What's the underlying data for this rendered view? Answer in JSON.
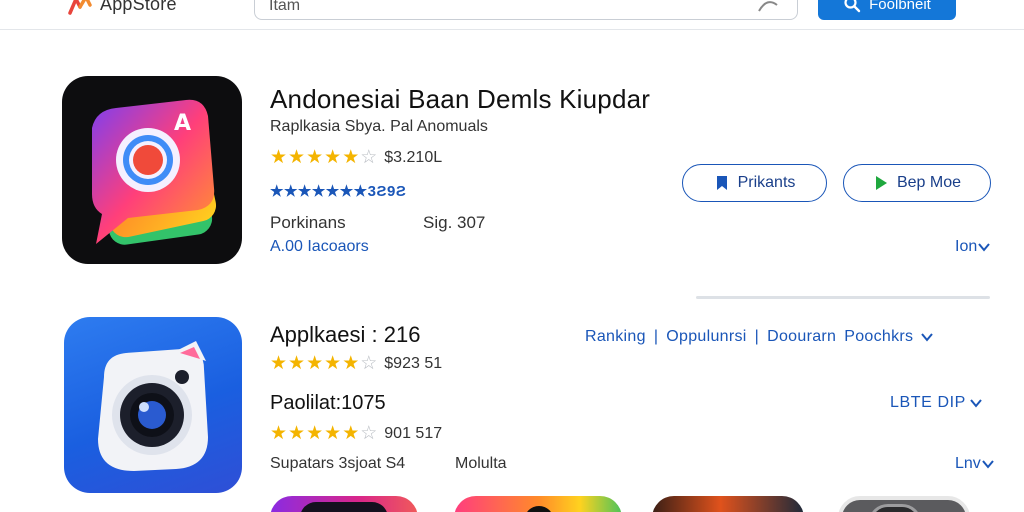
{
  "header": {
    "logo_text": "AppStore",
    "search_value": "Itam",
    "search_button_label": "Foolbneit",
    "accent_color": "#1477d8"
  },
  "featured_app": {
    "title": "Andonesiai Baan Demls Kiupdar",
    "subtitle": "Raplkasia Sbya. Pal Anomuals",
    "rating_value": "$3.210L",
    "rating_stars": 5,
    "rating_max": 5,
    "blue_text": "★★★★★★★3Ƨ9Ƨ",
    "meta_left": "Porkinans",
    "meta_right": "Sig. 307",
    "installs_text": "A.00 Iacoaors",
    "button_primary_label": "Prikants",
    "button_secondary_label": "Bep Moe",
    "more_label": "Ion"
  },
  "second_app": {
    "title": "Applkaesi : 216",
    "rating_value": "$923 51",
    "rating_stars": 4.5,
    "rating_max": 5,
    "ranking_items": [
      "Ranking",
      "Oppulunrsi",
      "Doourarn",
      "Poochkrs"
    ],
    "subtitle_title": "Paolilat:1075",
    "latest_label": "LBTE DIP",
    "rating2_value": "901 517",
    "rating2_stars": 5,
    "meta_left": "Supatars 3sjoat S4",
    "meta_right": "Molulta",
    "more_label": "Lnv"
  },
  "colors": {
    "star": "#f4b400",
    "link_blue": "#1a56b8",
    "border": "#c9ced5"
  }
}
